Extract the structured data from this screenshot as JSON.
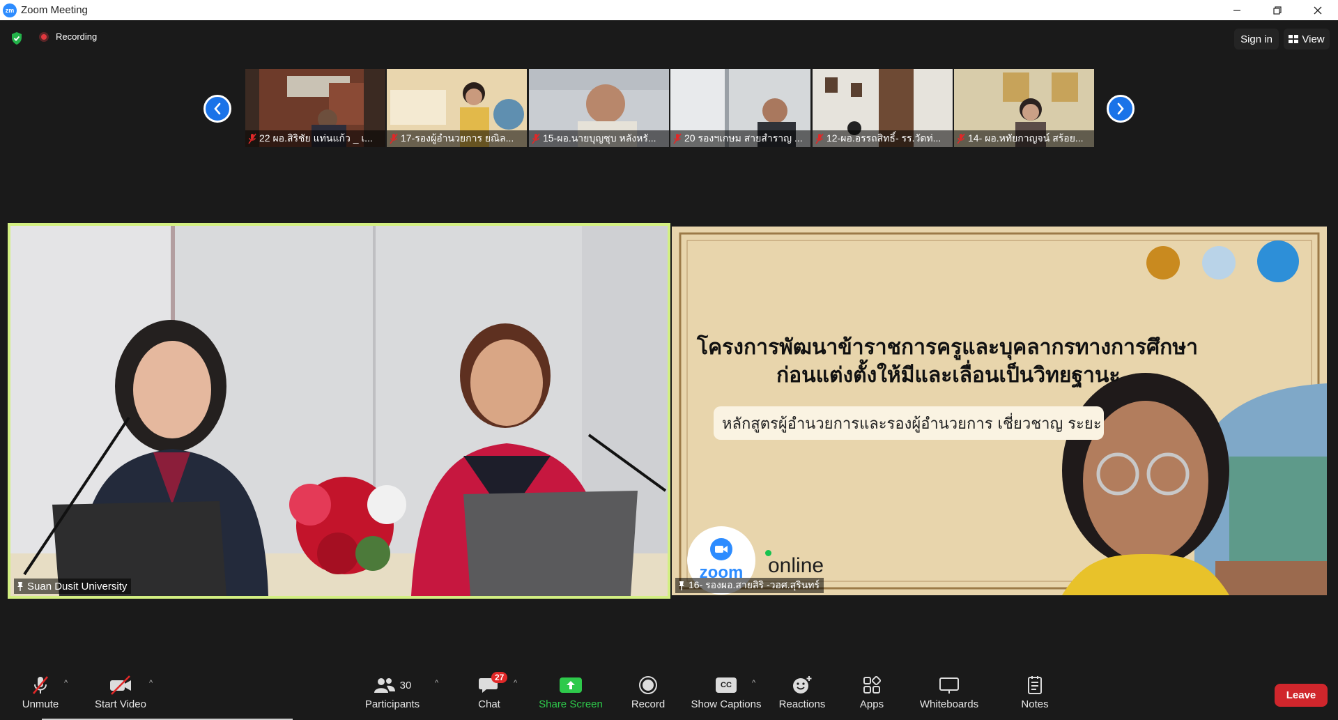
{
  "window": {
    "logo_text": "zm",
    "title": "Zoom Meeting"
  },
  "topbar": {
    "security_icon": "shield-check-icon",
    "recording_label": "Recording",
    "signin_label": "Sign in",
    "view_label": "View"
  },
  "thumbnails": [
    {
      "name": "22 ผอ.สิริชัย แท่นแก้ว _ เ...",
      "muted": true
    },
    {
      "name": "17-รองผู้อำนวยการ ยณิล...",
      "muted": true
    },
    {
      "name": "15-ผอ.นายบุญชุบ หลังหรั...",
      "muted": true
    },
    {
      "name": "20 รองฯเกษม สายสำราญ ...",
      "muted": true
    },
    {
      "name": "12-ผอ.อรรถสิทธิ์- รร.วัดท่...",
      "muted": true
    },
    {
      "name": "14- ผอ.หทัยกาญจน์ สร้อย...",
      "muted": true
    }
  ],
  "main_videos": {
    "left": {
      "name": "Suan Dusit University",
      "active_speaker": true
    },
    "right": {
      "name": "16- รองผอ.สายสิริ -วอศ.สุรินทร์",
      "slide_line1": "โครงการพัฒนาข้าราชการครูและบุคลากรทางการศึกษา",
      "slide_line2": "ก่อนแต่งตั้งให้มีและเลื่อนเป็นวิทยฐานะ",
      "slide_subtitle": "หลักสูตรผู้อำนวยการและรองผู้อำนวยการ เชี่ยวชาญ ระยะ",
      "zoom_badge": "zoom",
      "online_text": "online"
    }
  },
  "toolbar": {
    "unmute": "Unmute",
    "start_video": "Start Video",
    "participants": "Participants",
    "participants_count": "30",
    "chat": "Chat",
    "chat_badge": "27",
    "share_screen": "Share Screen",
    "record": "Record",
    "show_captions": "Show Captions",
    "captions_icon_text": "CC",
    "reactions": "Reactions",
    "apps": "Apps",
    "whiteboards": "Whiteboards",
    "notes": "Notes",
    "leave": "Leave"
  },
  "colors": {
    "active_speaker_border": "#d3ef82",
    "share_green": "#2ec94b",
    "leave_red": "#d0262c",
    "zoom_blue": "#2d8cff"
  }
}
